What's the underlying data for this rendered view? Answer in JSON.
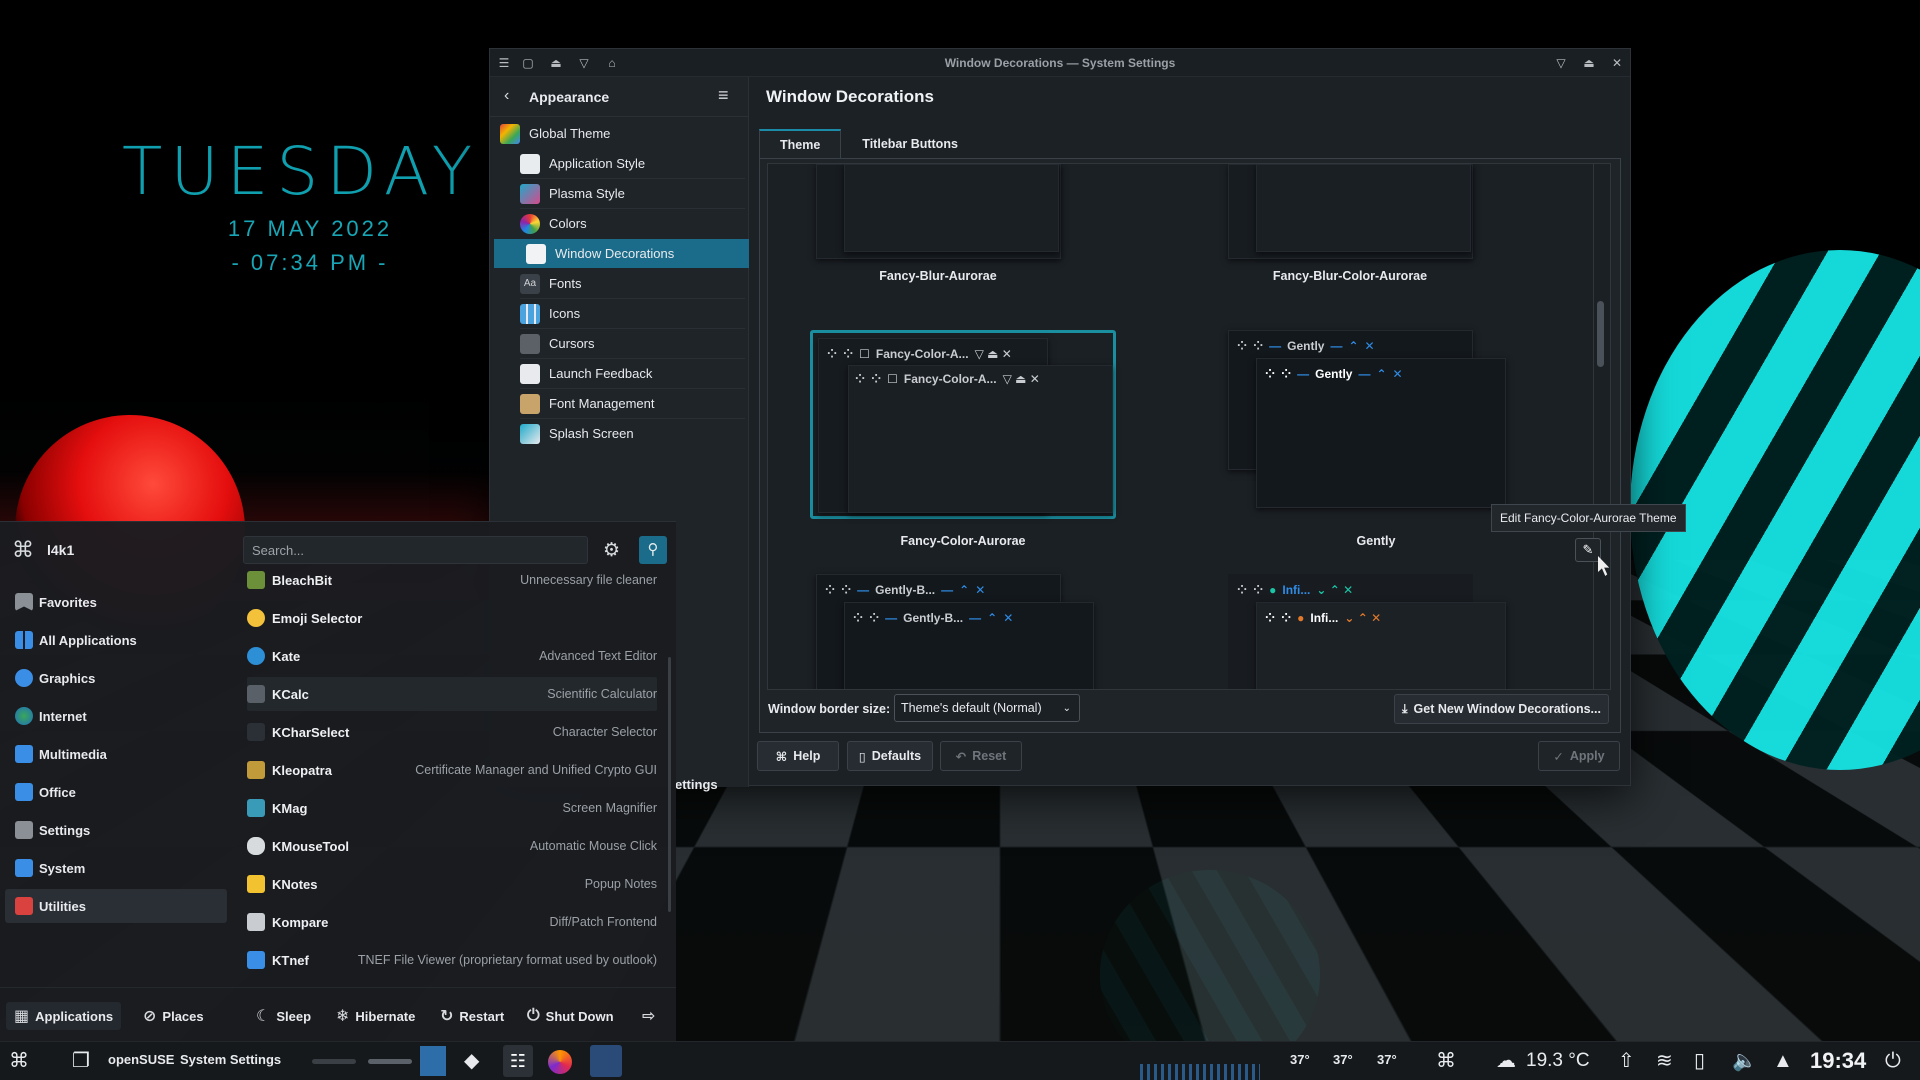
{
  "desktop": {
    "clock_day": "TUESDAY",
    "clock_date": "17 MAY 2022",
    "clock_time": "- 07:34 PM -"
  },
  "window": {
    "title": "Window Decorations — System Settings",
    "sidebar": {
      "back_label": "Appearance",
      "items": [
        {
          "label": "Global Theme",
          "icon": "global-theme-icon"
        },
        {
          "label": "Application Style",
          "icon": "application-style-icon"
        },
        {
          "label": "Plasma Style",
          "icon": "plasma-style-icon"
        },
        {
          "label": "Colors",
          "icon": "colors-icon"
        },
        {
          "label": "Window Decorations",
          "icon": "window-decorations-icon"
        },
        {
          "label": "Fonts",
          "icon": "fonts-icon"
        },
        {
          "label": "Icons",
          "icon": "icons-icon"
        },
        {
          "label": "Cursors",
          "icon": "cursors-icon"
        },
        {
          "label": "Launch Feedback",
          "icon": "launch-feedback-icon"
        },
        {
          "label": "Font Management",
          "icon": "font-management-icon"
        },
        {
          "label": "Splash Screen",
          "icon": "splash-screen-icon"
        }
      ],
      "partial_label": "ettings"
    },
    "page_title": "Window Decorations",
    "tabs": [
      "Theme",
      "Titlebar Buttons"
    ],
    "themes": [
      {
        "name": "Fancy-Blur-Aurorae"
      },
      {
        "name": "Fancy-Blur-Color-Aurorae"
      },
      {
        "name": "Fancy-Color-Aurorae",
        "preview_title_back": "Fancy-Color-A...",
        "preview_title_front": "Fancy-Color-A..."
      },
      {
        "name": "Gently",
        "preview_title_back": "Gently",
        "preview_title_front": "Gently"
      },
      {
        "name": "",
        "preview_title_back": "Gently-B...",
        "preview_title_front": "Gently-B..."
      },
      {
        "name": "",
        "preview_title_back": "Infi...",
        "preview_title_front": "Infi..."
      }
    ],
    "tooltip": "Edit Fancy-Color-Aurorae Theme",
    "border_size_label": "Window border size:",
    "border_size_value": "Theme's default (Normal)",
    "get_new_label": "Get New Window Decorations...",
    "buttons": {
      "help": "Help",
      "defaults": "Defaults",
      "reset": "Reset",
      "apply": "Apply"
    },
    "accent_color": "#1a8fa0"
  },
  "launcher": {
    "user": "l4k1",
    "search_placeholder": "Search...",
    "categories": [
      {
        "label": "Favorites",
        "icon": "favorites-icon"
      },
      {
        "label": "All Applications",
        "icon": "all-applications-icon"
      },
      {
        "label": "Graphics",
        "icon": "graphics-icon"
      },
      {
        "label": "Internet",
        "icon": "internet-icon"
      },
      {
        "label": "Multimedia",
        "icon": "multimedia-icon"
      },
      {
        "label": "Office",
        "icon": "office-icon"
      },
      {
        "label": "Settings",
        "icon": "settings-icon"
      },
      {
        "label": "System",
        "icon": "system-icon"
      },
      {
        "label": "Utilities",
        "icon": "utilities-icon"
      }
    ],
    "apps": [
      {
        "name": "BleachBit",
        "desc": "Unnecessary file cleaner"
      },
      {
        "name": "Emoji Selector",
        "desc": ""
      },
      {
        "name": "Kate",
        "desc": "Advanced Text Editor"
      },
      {
        "name": "KCalc",
        "desc": "Scientific Calculator"
      },
      {
        "name": "KCharSelect",
        "desc": "Character Selector"
      },
      {
        "name": "Kleopatra",
        "desc": "Certificate Manager and Unified Crypto GUI"
      },
      {
        "name": "KMag",
        "desc": "Screen Magnifier"
      },
      {
        "name": "KMouseTool",
        "desc": "Automatic Mouse Click"
      },
      {
        "name": "KNotes",
        "desc": "Popup Notes"
      },
      {
        "name": "Kompare",
        "desc": "Diff/Patch Frontend"
      },
      {
        "name": "KTnef",
        "desc": "TNEF File Viewer (proprietary format used by outlook)"
      }
    ],
    "footer": {
      "applications": "Applications",
      "places": "Places",
      "sleep": "Sleep",
      "hibernate": "Hibernate",
      "restart": "Restart",
      "shutdown": "Shut Down"
    }
  },
  "taskbar": {
    "distro": "openSUSE",
    "task": "System Settings",
    "temps": [
      "37°",
      "37°",
      "37°"
    ],
    "weather": "19.3 °C",
    "clock": "19:34"
  }
}
